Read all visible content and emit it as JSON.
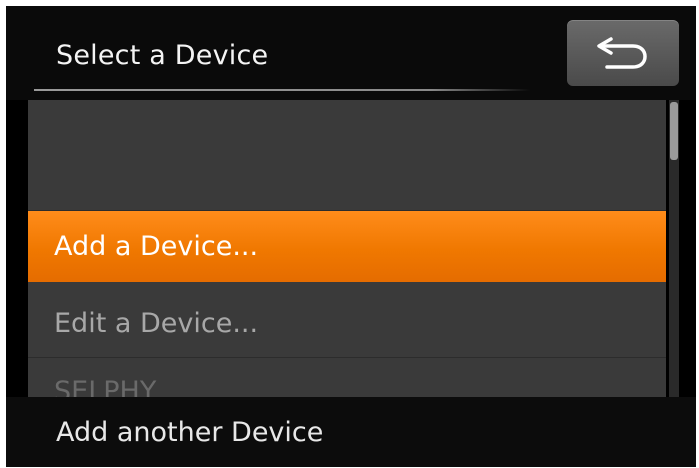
{
  "header": {
    "title": "Select a Device"
  },
  "back_button": {
    "icon": "back-arrow-icon"
  },
  "device_list": {
    "items": [
      {
        "label": "Add a Device...",
        "selected": true
      },
      {
        "label": "Edit a Device...",
        "selected": false
      },
      {
        "label": "SELPHY",
        "selected": false
      }
    ]
  },
  "footer": {
    "hint": "Add another Device"
  },
  "colors": {
    "highlight": "#f07800",
    "panel": "#3a3a3a",
    "background": "#000000"
  }
}
